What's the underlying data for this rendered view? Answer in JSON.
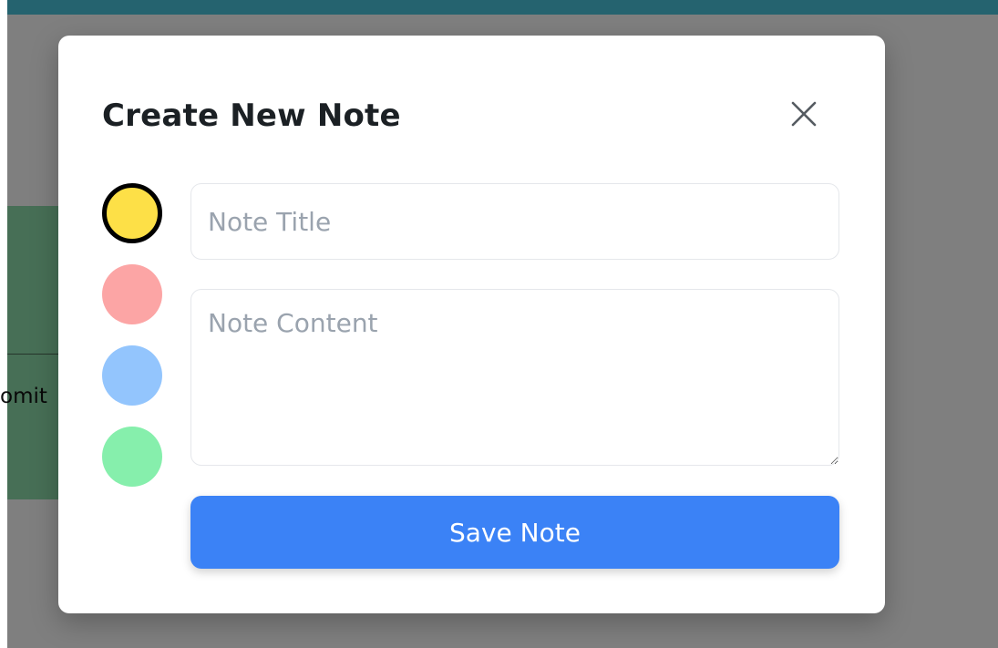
{
  "background": {
    "partial_text": "omit"
  },
  "modal": {
    "title": "Create New Note",
    "close_icon": "close-icon",
    "colors": [
      {
        "name": "yellow",
        "hex": "#fde047",
        "selected": true
      },
      {
        "name": "red",
        "hex": "#fca5a5",
        "selected": false
      },
      {
        "name": "blue",
        "hex": "#93c5fd",
        "selected": false
      },
      {
        "name": "green",
        "hex": "#86efac",
        "selected": false
      }
    ],
    "title_field": {
      "placeholder": "Note Title",
      "value": ""
    },
    "content_field": {
      "placeholder": "Note Content",
      "value": ""
    },
    "save_label": "Save Note"
  },
  "theme": {
    "topbar": "#25636f",
    "overlay": "rgba(0,0,0,0.5)",
    "accent": "#3b82f6"
  }
}
